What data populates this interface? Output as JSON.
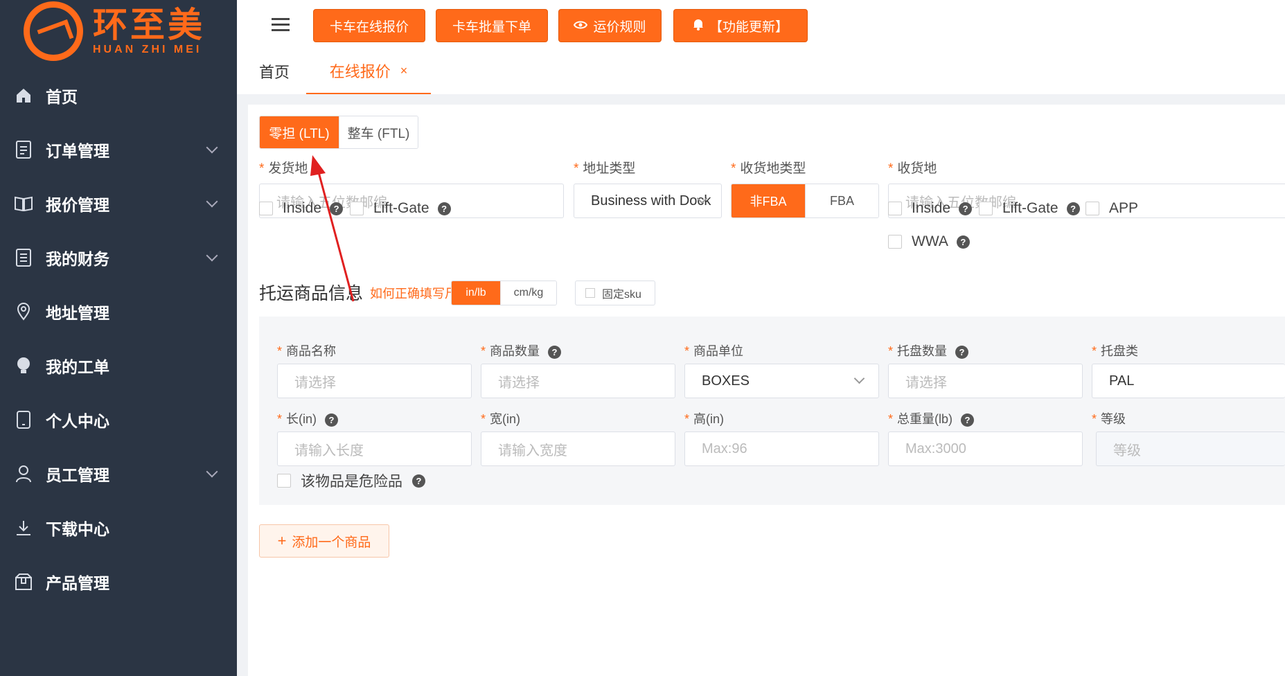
{
  "brand": {
    "name_cn": "环至美",
    "name_en": "HUAN ZHI MEI"
  },
  "colors": {
    "accent": "#ff6a1a",
    "sidebar_bg": "#2b3544"
  },
  "sidebar": {
    "items": [
      {
        "label": "首页",
        "icon": "home-icon",
        "expandable": false
      },
      {
        "label": "订单管理",
        "icon": "document-icon",
        "expandable": true
      },
      {
        "label": "报价管理",
        "icon": "book-icon",
        "expandable": true
      },
      {
        "label": "我的财务",
        "icon": "ledger-icon",
        "expandable": true
      },
      {
        "label": "地址管理",
        "icon": "location-icon",
        "expandable": false
      },
      {
        "label": "我的工单",
        "icon": "lightbulb-icon",
        "expandable": false
      },
      {
        "label": "个人中心",
        "icon": "phone-icon",
        "expandable": false
      },
      {
        "label": "员工管理",
        "icon": "user-icon",
        "expandable": true
      },
      {
        "label": "下载中心",
        "icon": "download-icon",
        "expandable": false
      },
      {
        "label": "产品管理",
        "icon": "package-icon",
        "expandable": false
      }
    ]
  },
  "topbar": {
    "buttons": [
      {
        "label": "卡车在线报价",
        "icon": ""
      },
      {
        "label": "卡车批量下单",
        "icon": ""
      },
      {
        "label": "运价规则",
        "icon": "eye-icon"
      },
      {
        "label": "【功能更新】",
        "icon": "bell-icon"
      }
    ]
  },
  "tabs": {
    "home": "首页",
    "active": "在线报价",
    "close": "×"
  },
  "mode": {
    "ltl": "零担 (LTL)",
    "ftl": "整车 (FTL)"
  },
  "shipping": {
    "origin_label": "发货地",
    "origin_placeholder": "请输入五位数邮编",
    "addr_type_label": "地址类型",
    "addr_type_value": "Business with Dock",
    "dest_type_label": "收货地类型",
    "dest_type_options": [
      "非FBA",
      "FBA"
    ],
    "dest_label": "收货地",
    "dest_placeholder": "请输入五位数邮编",
    "origin_options": [
      "Inside",
      "Lift-Gate"
    ],
    "dest_options": [
      "Inside",
      "Lift-Gate",
      "APP",
      "WWA"
    ]
  },
  "goods": {
    "title": "托运商品信息",
    "howto_link": "如何正确填写尺寸",
    "unit_options": [
      "in/lb",
      "cm/kg"
    ],
    "fixed_sku": "固定sku",
    "name_label": "商品名称",
    "name_placeholder": "请选择",
    "qty_label": "商品数量",
    "qty_placeholder": "请选择",
    "unit_label": "商品单位",
    "unit_value": "BOXES",
    "pallet_qty_label": "托盘数量",
    "pallet_qty_placeholder": "请选择",
    "pallet_type_label": "托盘类",
    "pallet_type_value": "PAL",
    "length_label": "长(in)",
    "length_placeholder": "请输入长度",
    "width_label": "宽(in)",
    "width_placeholder": "请输入宽度",
    "height_label": "高(in)",
    "height_placeholder": "Max:96",
    "weight_label": "总重量(lb)",
    "weight_placeholder": "Max:3000",
    "class_label": "等级",
    "class_placeholder": "等级",
    "dangerous": "该物品是危险品",
    "add_button": "添加一个商品"
  },
  "help_glyph": "?",
  "req_mark": "*",
  "plus_glyph": "+"
}
